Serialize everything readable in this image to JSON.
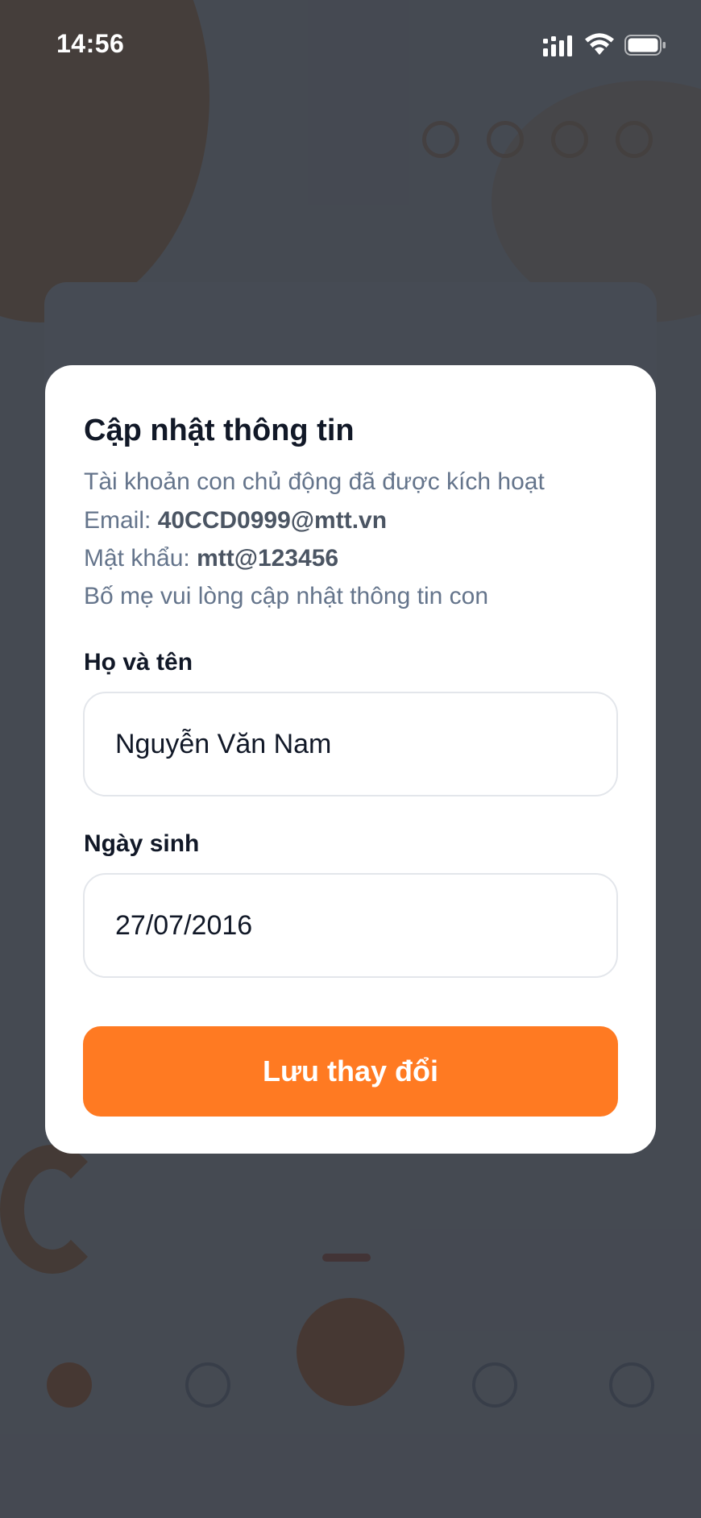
{
  "status_bar": {
    "time": "14:56",
    "icons": [
      "cellular-signal-icon",
      "wifi-icon",
      "battery-icon"
    ]
  },
  "modal": {
    "title": "Cập nhật thông tin",
    "description": {
      "activated": "Tài khoản con chủ động đã được kích hoạt",
      "email_label": "Email: ",
      "email_value": "40CCD0999@mtt.vn",
      "password_label": "Mật khẩu: ",
      "password_value": "mtt@123456",
      "instruction": "Bố mẹ vui lòng cập nhật thông tin con"
    },
    "fields": {
      "name_label": "Họ và tên",
      "name_value": "Nguyễn Văn Nam",
      "dob_label": "Ngày sinh",
      "dob_value": "27/07/2016"
    },
    "save_label": "Lưu thay đổi"
  },
  "colors": {
    "accent": "#ff7a22",
    "title": "#111827",
    "muted_text": "#64748b",
    "overlay": "#282d38",
    "field_border": "#e3e6eb"
  }
}
